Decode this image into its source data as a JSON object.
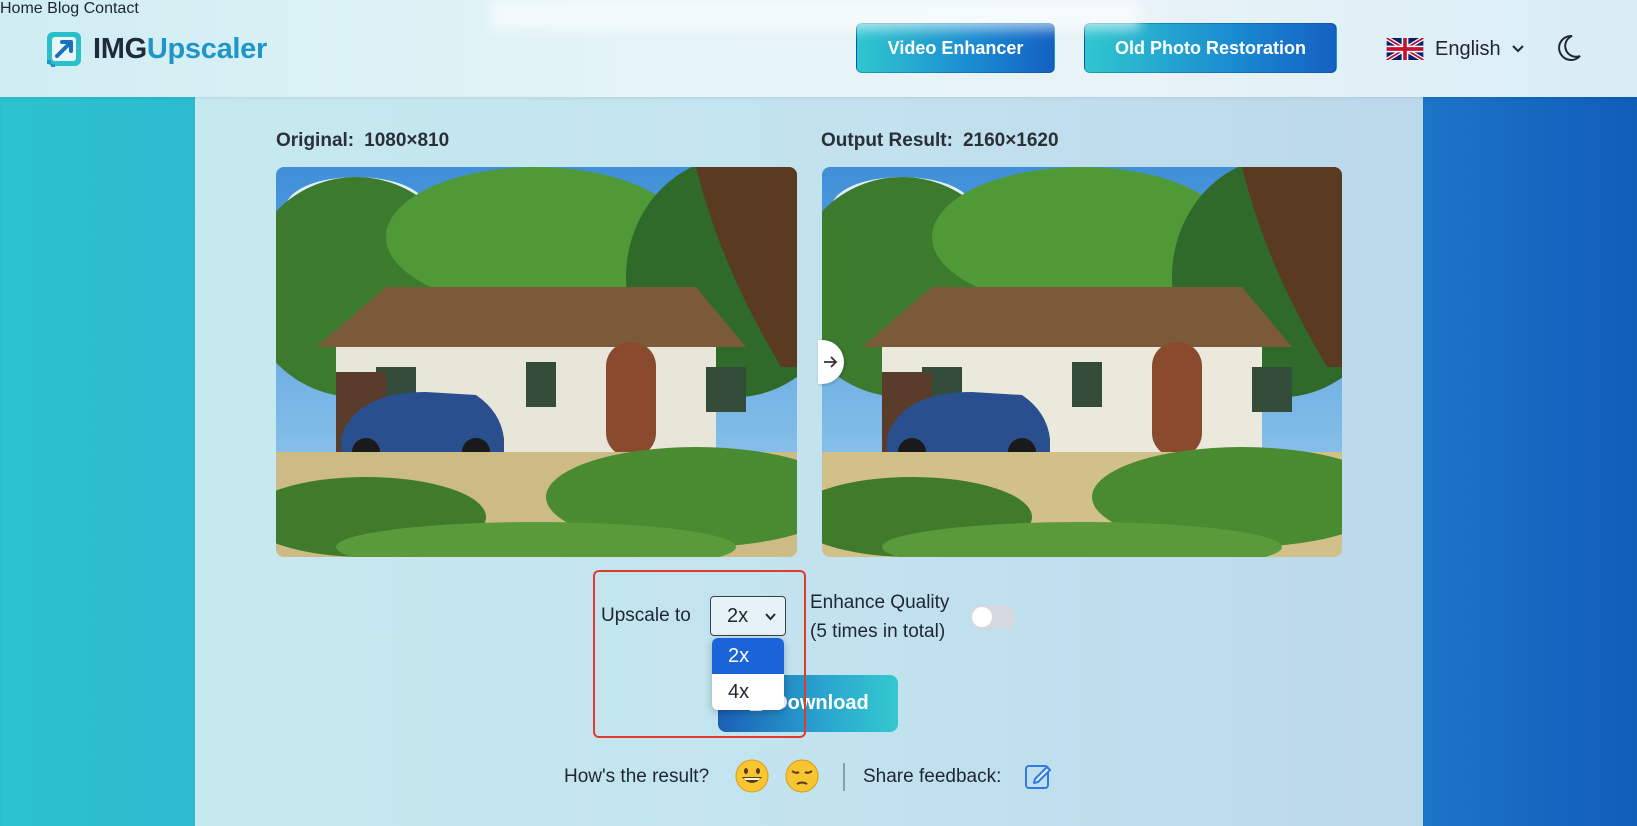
{
  "header": {
    "logo": {
      "part1": "IMG",
      "part2": "Upscaler"
    },
    "nav": [
      {
        "label": "Home"
      },
      {
        "label": "Blog"
      },
      {
        "label": "Contact"
      }
    ],
    "cta_video": "Video Enhancer",
    "cta_restore": "Old Photo Restoration",
    "language": "English",
    "icons": {
      "language_flag": "uk-flag-icon",
      "theme_toggle": "moon-icon"
    }
  },
  "comparison": {
    "original_label": "Original:",
    "original_size": "1080×810",
    "output_label": "Output Result:",
    "output_size": "2160×1620",
    "images": [
      "cottage-with-blue-car-original",
      "cottage-with-blue-car-upscaled"
    ]
  },
  "controls": {
    "upscale_label": "Upscale to",
    "upscale_value": "2x",
    "upscale_options": [
      "2x",
      "4x"
    ],
    "enhance_label_line1": "Enhance Quality",
    "enhance_label_line2": "(5 times in total)",
    "enhance_enabled": false,
    "download_label": "Download"
  },
  "feedback": {
    "question": "How's the result?",
    "share_label": "Share feedback:",
    "icons": [
      "grinning-face-emoji",
      "pensive-face-emoji",
      "edit-icon"
    ]
  },
  "colors": {
    "accent_start": "#2fc7cf",
    "accent_end": "#1460c2",
    "highlight": "#e03c2e",
    "dropdown_selected": "#1a63d9"
  }
}
